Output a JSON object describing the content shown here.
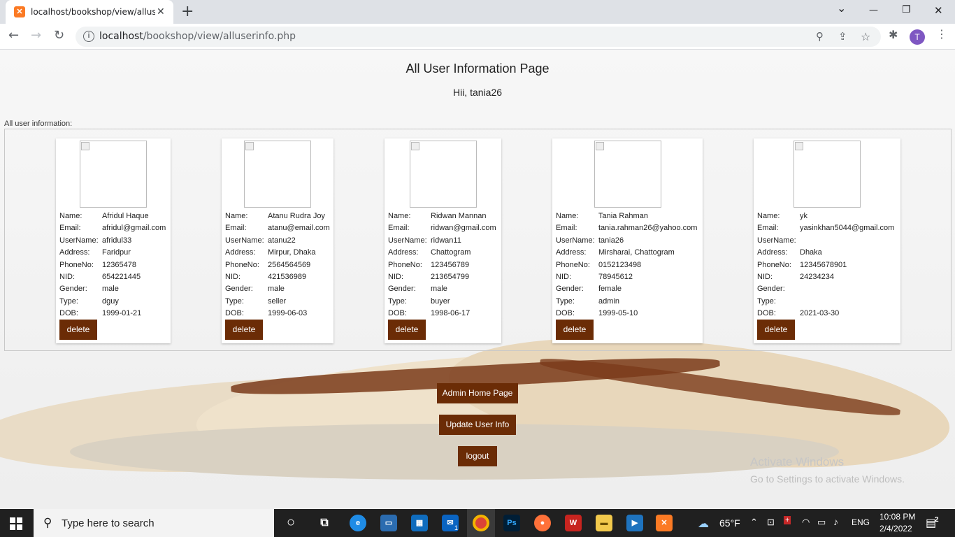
{
  "browser": {
    "tab_title": "localhost/bookshop/view/alluseri",
    "tab_close": "✕",
    "new_tab": "+",
    "url_host": "localhost",
    "url_path": "/bookshop/view/alluserinfo.php",
    "profile_initial": "T",
    "window_controls": {
      "dropdown": "⌄",
      "minimize": "—",
      "restore": "❐",
      "close": "✕"
    }
  },
  "page": {
    "title": "All User Information Page",
    "greeting": "Hii, tania26",
    "section_label": "All user information:",
    "field_labels": {
      "name": "Name:",
      "email": "Email:",
      "username": "UserName:",
      "address": "Address:",
      "phone": "PhoneNo:",
      "nid": "NID:",
      "gender": "Gender:",
      "type": "Type:",
      "dob": "DOB:"
    },
    "delete_label": "delete",
    "users": [
      {
        "name": "Afridul Haque",
        "email": "afridul@gmail.com",
        "username": "afridul33",
        "address": "Faridpur",
        "phone": "12365478",
        "nid": "654221445",
        "gender": "male",
        "type": "dguy",
        "dob": "1999-01-21"
      },
      {
        "name": "Atanu Rudra Joy",
        "email": "atanu@email.com",
        "username": "atanu22",
        "address": "Mirpur, Dhaka",
        "phone": "2564564569",
        "nid": "421536989",
        "gender": "male",
        "type": "seller",
        "dob": "1999-06-03"
      },
      {
        "name": "Ridwan Mannan",
        "email": "ridwan@gmail.com",
        "username": "ridwan11",
        "address": "Chattogram",
        "phone": "123456789",
        "nid": "213654799",
        "gender": "male",
        "type": "buyer",
        "dob": "1998-06-17"
      },
      {
        "name": "Tania Rahman",
        "email": "tania.rahman26@yahoo.com",
        "username": "tania26",
        "address": "Mirsharai, Chattogram",
        "phone": "0152123498",
        "nid": "78945612",
        "gender": "female",
        "type": "admin",
        "dob": "1999-05-10"
      },
      {
        "name": "yk",
        "email": "yasinkhan5044@gmail.com",
        "username": "",
        "address": "Dhaka",
        "phone": "12345678901",
        "nid": "24234234",
        "gender": "",
        "type": "",
        "dob": "2021-03-30"
      }
    ],
    "buttons": {
      "admin_home": "Admin Home Page",
      "update_user": "Update User Info",
      "logout": "logout"
    },
    "watermark_title": "Activate Windows",
    "watermark_sub": "Go to Settings to activate Windows."
  },
  "taskbar": {
    "search_placeholder": "Type here to search",
    "weather": "65°F",
    "language": "ENG",
    "time": "10:08 PM",
    "date": "2/4/2022",
    "notification_count": "2",
    "mail_badge": "1"
  }
}
